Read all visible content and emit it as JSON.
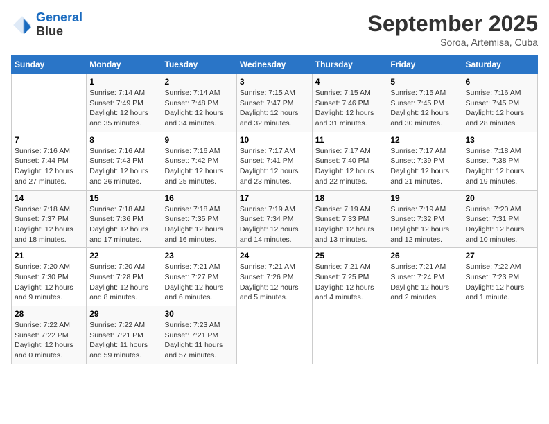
{
  "header": {
    "logo_line1": "General",
    "logo_line2": "Blue",
    "month": "September 2025",
    "location": "Soroa, Artemisa, Cuba"
  },
  "weekdays": [
    "Sunday",
    "Monday",
    "Tuesday",
    "Wednesday",
    "Thursday",
    "Friday",
    "Saturday"
  ],
  "weeks": [
    [
      {
        "day": "",
        "info": ""
      },
      {
        "day": "1",
        "info": "Sunrise: 7:14 AM\nSunset: 7:49 PM\nDaylight: 12 hours\nand 35 minutes."
      },
      {
        "day": "2",
        "info": "Sunrise: 7:14 AM\nSunset: 7:48 PM\nDaylight: 12 hours\nand 34 minutes."
      },
      {
        "day": "3",
        "info": "Sunrise: 7:15 AM\nSunset: 7:47 PM\nDaylight: 12 hours\nand 32 minutes."
      },
      {
        "day": "4",
        "info": "Sunrise: 7:15 AM\nSunset: 7:46 PM\nDaylight: 12 hours\nand 31 minutes."
      },
      {
        "day": "5",
        "info": "Sunrise: 7:15 AM\nSunset: 7:45 PM\nDaylight: 12 hours\nand 30 minutes."
      },
      {
        "day": "6",
        "info": "Sunrise: 7:16 AM\nSunset: 7:45 PM\nDaylight: 12 hours\nand 28 minutes."
      }
    ],
    [
      {
        "day": "7",
        "info": "Sunrise: 7:16 AM\nSunset: 7:44 PM\nDaylight: 12 hours\nand 27 minutes."
      },
      {
        "day": "8",
        "info": "Sunrise: 7:16 AM\nSunset: 7:43 PM\nDaylight: 12 hours\nand 26 minutes."
      },
      {
        "day": "9",
        "info": "Sunrise: 7:16 AM\nSunset: 7:42 PM\nDaylight: 12 hours\nand 25 minutes."
      },
      {
        "day": "10",
        "info": "Sunrise: 7:17 AM\nSunset: 7:41 PM\nDaylight: 12 hours\nand 23 minutes."
      },
      {
        "day": "11",
        "info": "Sunrise: 7:17 AM\nSunset: 7:40 PM\nDaylight: 12 hours\nand 22 minutes."
      },
      {
        "day": "12",
        "info": "Sunrise: 7:17 AM\nSunset: 7:39 PM\nDaylight: 12 hours\nand 21 minutes."
      },
      {
        "day": "13",
        "info": "Sunrise: 7:18 AM\nSunset: 7:38 PM\nDaylight: 12 hours\nand 19 minutes."
      }
    ],
    [
      {
        "day": "14",
        "info": "Sunrise: 7:18 AM\nSunset: 7:37 PM\nDaylight: 12 hours\nand 18 minutes."
      },
      {
        "day": "15",
        "info": "Sunrise: 7:18 AM\nSunset: 7:36 PM\nDaylight: 12 hours\nand 17 minutes."
      },
      {
        "day": "16",
        "info": "Sunrise: 7:18 AM\nSunset: 7:35 PM\nDaylight: 12 hours\nand 16 minutes."
      },
      {
        "day": "17",
        "info": "Sunrise: 7:19 AM\nSunset: 7:34 PM\nDaylight: 12 hours\nand 14 minutes."
      },
      {
        "day": "18",
        "info": "Sunrise: 7:19 AM\nSunset: 7:33 PM\nDaylight: 12 hours\nand 13 minutes."
      },
      {
        "day": "19",
        "info": "Sunrise: 7:19 AM\nSunset: 7:32 PM\nDaylight: 12 hours\nand 12 minutes."
      },
      {
        "day": "20",
        "info": "Sunrise: 7:20 AM\nSunset: 7:31 PM\nDaylight: 12 hours\nand 10 minutes."
      }
    ],
    [
      {
        "day": "21",
        "info": "Sunrise: 7:20 AM\nSunset: 7:30 PM\nDaylight: 12 hours\nand 9 minutes."
      },
      {
        "day": "22",
        "info": "Sunrise: 7:20 AM\nSunset: 7:28 PM\nDaylight: 12 hours\nand 8 minutes."
      },
      {
        "day": "23",
        "info": "Sunrise: 7:21 AM\nSunset: 7:27 PM\nDaylight: 12 hours\nand 6 minutes."
      },
      {
        "day": "24",
        "info": "Sunrise: 7:21 AM\nSunset: 7:26 PM\nDaylight: 12 hours\nand 5 minutes."
      },
      {
        "day": "25",
        "info": "Sunrise: 7:21 AM\nSunset: 7:25 PM\nDaylight: 12 hours\nand 4 minutes."
      },
      {
        "day": "26",
        "info": "Sunrise: 7:21 AM\nSunset: 7:24 PM\nDaylight: 12 hours\nand 2 minutes."
      },
      {
        "day": "27",
        "info": "Sunrise: 7:22 AM\nSunset: 7:23 PM\nDaylight: 12 hours\nand 1 minute."
      }
    ],
    [
      {
        "day": "28",
        "info": "Sunrise: 7:22 AM\nSunset: 7:22 PM\nDaylight: 12 hours\nand 0 minutes."
      },
      {
        "day": "29",
        "info": "Sunrise: 7:22 AM\nSunset: 7:21 PM\nDaylight: 11 hours\nand 59 minutes."
      },
      {
        "day": "30",
        "info": "Sunrise: 7:23 AM\nSunset: 7:21 PM\nDaylight: 11 hours\nand 57 minutes."
      },
      {
        "day": "",
        "info": ""
      },
      {
        "day": "",
        "info": ""
      },
      {
        "day": "",
        "info": ""
      },
      {
        "day": "",
        "info": ""
      }
    ]
  ]
}
